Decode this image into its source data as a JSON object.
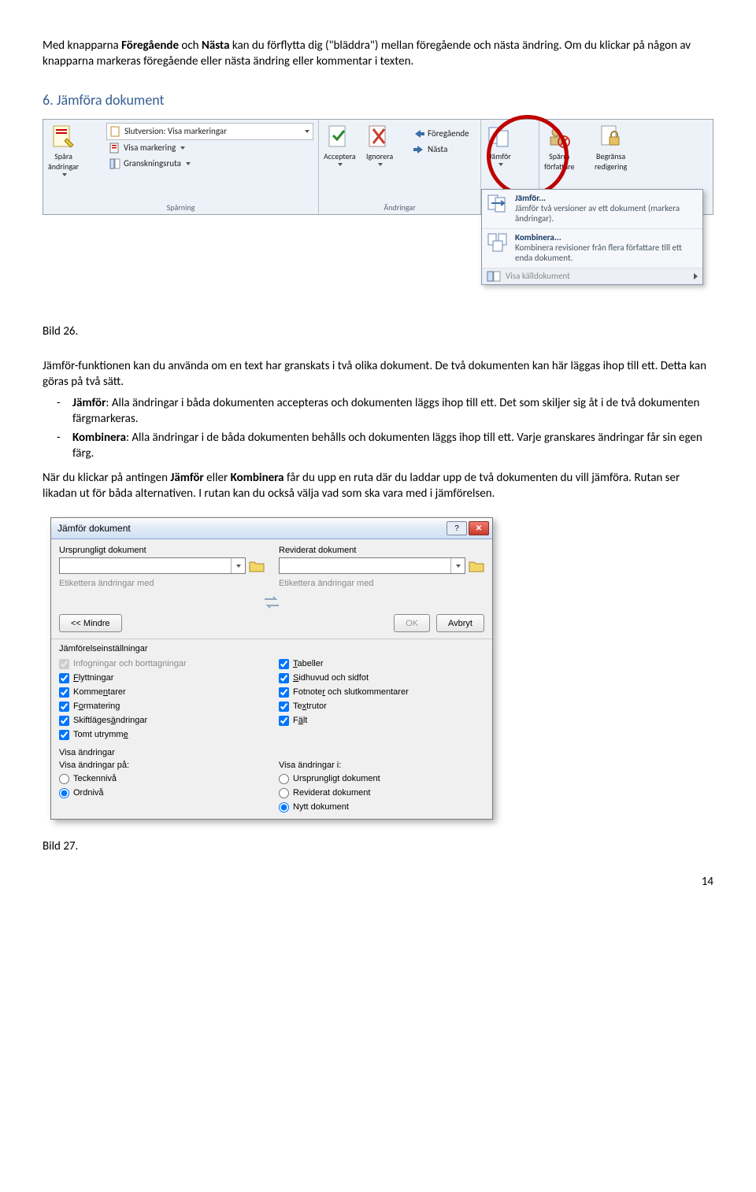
{
  "intro": {
    "p1a": "Med knapparna ",
    "p1b": "Föregående",
    "p1c": " och ",
    "p1d": "Nästa",
    "p1e": " kan du förflytta dig (\"bläddra\") mellan föregående och nästa ändring. Om du klickar på någon av knapparna markeras föregående eller nästa ändring eller kommentar i texten."
  },
  "section6": "6. Jämföra dokument",
  "ribbon": {
    "group_tracking": "Spårning",
    "group_changes": "Ändringar",
    "spara_andringar": "Spåra\nändringar",
    "slutversion": "Slutversion: Visa markeringar",
    "visa_markering": "Visa markering",
    "granskningsruta": "Granskningsruta",
    "acceptera": "Acceptera",
    "ignorera": "Ignorera",
    "foregaende": "Föregående",
    "nasta": "Nästa",
    "jamfor": "Jämför",
    "sparr_forfattare": "Spärra\nförfattare",
    "begransa_redigering": "Begränsa\nredigering",
    "dd_jamfor_title": "Jämför...",
    "dd_jamfor_desc": "Jämför två versioner av ett dokument (markera ändringar).",
    "dd_kombinera_title": "Kombinera...",
    "dd_kombinera_desc": "Kombinera revisioner från flera författare till ett enda dokument.",
    "dd_visa_kalldokument": "Visa källdokument"
  },
  "bild26": "Bild 26.",
  "after26": {
    "p1": "Jämför-funktionen kan du använda om en text har granskats i två olika dokument. De två dokumenten kan här läggas ihop till ett. Detta kan göras på två sätt.",
    "li1a": "Jämför",
    "li1b": ": Alla ändringar i båda dokumenten accepteras och dokumenten läggs ihop till ett. Det som skiljer sig åt i de två dokumenten färgmarkeras.",
    "li2a": "Kombinera",
    "li2b": ": Alla ändringar i de båda dokumenten behålls och dokumenten läggs ihop till ett. Varje granskares ändringar får sin egen färg.",
    "p2a": "När du klickar på antingen ",
    "p2b": "Jämför",
    "p2c": " eller ",
    "p2d": "Kombinera",
    "p2e": " får du upp en ruta där du laddar upp de två dokumenten du vill jämföra. Rutan ser likadan ut för båda alternativen. I rutan kan du också välja vad som ska vara med i jämförelsen."
  },
  "dialog": {
    "title": "Jämför dokument",
    "orig_doc": "Ursprungligt dokument",
    "rev_doc": "Reviderat dokument",
    "label_changes": "Etikettera ändringar med",
    "btn_less": "<< Mindre",
    "btn_ok": "OK",
    "btn_cancel": "Avbryt",
    "settings_h": "Jämförelseinställningar",
    "chk_insertions": "Infogningar och borttagningar",
    "chk_moves": "Flyttningar",
    "chk_comments": "Kommentarer",
    "chk_formatting": "Formatering",
    "chk_case": "Skiftlägesändringar",
    "chk_whitespace": "Tomt utrymme",
    "chk_tables": "Tabeller",
    "chk_headers": "Sidhuvud och sidfot",
    "chk_footnotes": "Fotnoter och slutkommentarer",
    "chk_textboxes": "Textrutor",
    "chk_fields": "Fält",
    "show_h": "Visa ändringar",
    "show_on": "Visa ändringar på:",
    "show_in": "Visa ändringar i:",
    "r_char": "Teckennivå",
    "r_word": "Ordnivå",
    "r_orig": "Ursprungligt dokument",
    "r_rev": "Reviderat dokument",
    "r_new": "Nytt dokument"
  },
  "bild27": "Bild 27.",
  "pagenum": "14"
}
